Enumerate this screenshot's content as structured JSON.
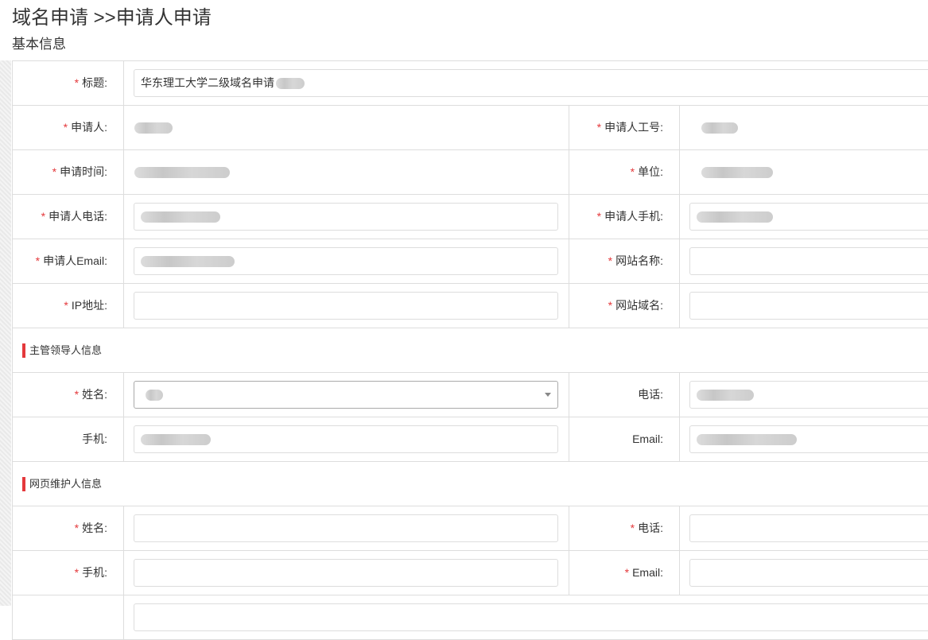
{
  "header": {
    "title": "域名申请 >>申请人申请",
    "section": "基本信息"
  },
  "required_mark": "*",
  "basic": {
    "title_label": "标题:",
    "title_value": "华东理工大学二级域名申请",
    "applicant_label": "申请人:",
    "staff_no_label": "申请人工号:",
    "apply_time_label": "申请时间:",
    "unit_label": "单位:",
    "phone_label": "申请人电话:",
    "mobile_label": "申请人手机:",
    "email_label": "申请人Email:",
    "site_name_label": "网站名称:",
    "ip_label": "IP地址:",
    "site_domain_label": "网站域名:"
  },
  "leader": {
    "group_title": "主管领导人信息",
    "name_label": "姓名:",
    "phone_label": "电话:",
    "mobile_label": "手机:",
    "email_label": "Email:"
  },
  "maintainer": {
    "group_title": "网页维护人信息",
    "name_label": "姓名:",
    "phone_label": "电话:",
    "mobile_label": "手机:",
    "email_label": "Email:"
  },
  "colors": {
    "required": "#e4393c",
    "border": "#dddddd",
    "group_bar": "#e4393c"
  }
}
